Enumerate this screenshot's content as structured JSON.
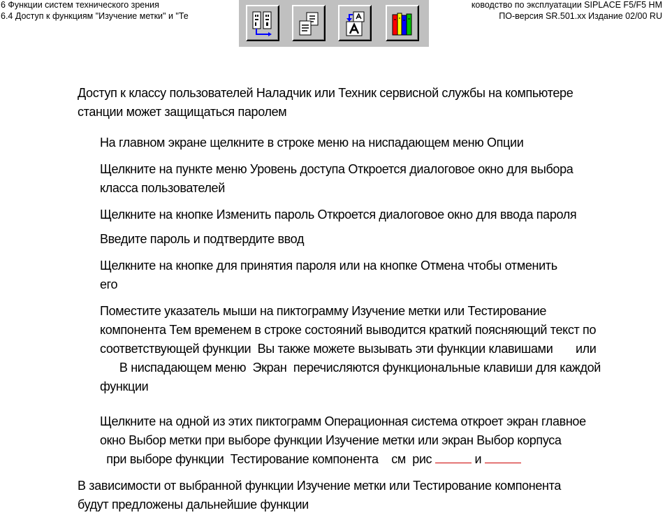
{
  "header": {
    "chapter": "6 Функции систем технического зрения",
    "section": "6.4 Доступ к функциям \"Изучение метки\" и \"Те",
    "manual": "ководство по эксплуатации SIPLACE F5/F5 HM",
    "edition": "ПО-версия SR.501.xx   Издание 02/00 RU"
  },
  "toolbar": {
    "icons": [
      "mark-teach-icon",
      "windows-stack-icon",
      "font-a-icon",
      "books-icon"
    ],
    "colors": {
      "face": "#c0c0c0",
      "blue": "#0000ff",
      "red": "#ff0000",
      "yellow": "#ffff00",
      "green": "#00c000"
    }
  },
  "body": {
    "intro_l1": "Доступ к классу пользователей  Наладчик  или  Техник сервисной службы  на компьютере",
    "intro_l2": "станции может защищаться паролем",
    "s1": "На главном экране щелкните в строке меню на ниспадающем меню  Опции",
    "s2_l1": "Щелкните на пункте меню  Уровень доступа   Откроется диалоговое окно для выбора",
    "s2_l2": "класса пользователей",
    "s3": "Щелкните на кнопке  Изменить пароль   Откроется диалоговое окно для ввода пароля",
    "s4": "Введите пароль и подтвердите ввод",
    "s5_l1": "Щелкните на кнопке         для принятия пароля или на кнопке  Отмена   чтобы отменить",
    "s5_l2": "его",
    "s6_l1": "Поместите указатель мыши на пиктограмму  Изучение метки  или  Тестирование",
    "s6_l2": "компонента   Тем временем в строке состояний выводится краткий поясняющий текст по",
    "s6_l3": "соответствующей функции  Вы также можете вызывать эти функции клавишами       или",
    "s6_l4": "      В ниспадающем меню  Экран  перечисляются функциональные клавиши для каждой",
    "s6_l5": "функции",
    "s7_l1": "Щелкните на одной из этих пиктограмм  Операционная система откроет экран  главное",
    "s7_l2": "окно   Выбор метки   при выборе функции  Изучение метки   или экран  Выбор корпуса",
    "s7_l3": "  при выборе функции  Тестирование компонента    см  рис ",
    "s7_and": " и ",
    "final_l1": "В зависимости от выбранной функции   Изучение метки  или  Тестирование компонента",
    "final_l2": "будут предложены дальнейшие функции"
  }
}
